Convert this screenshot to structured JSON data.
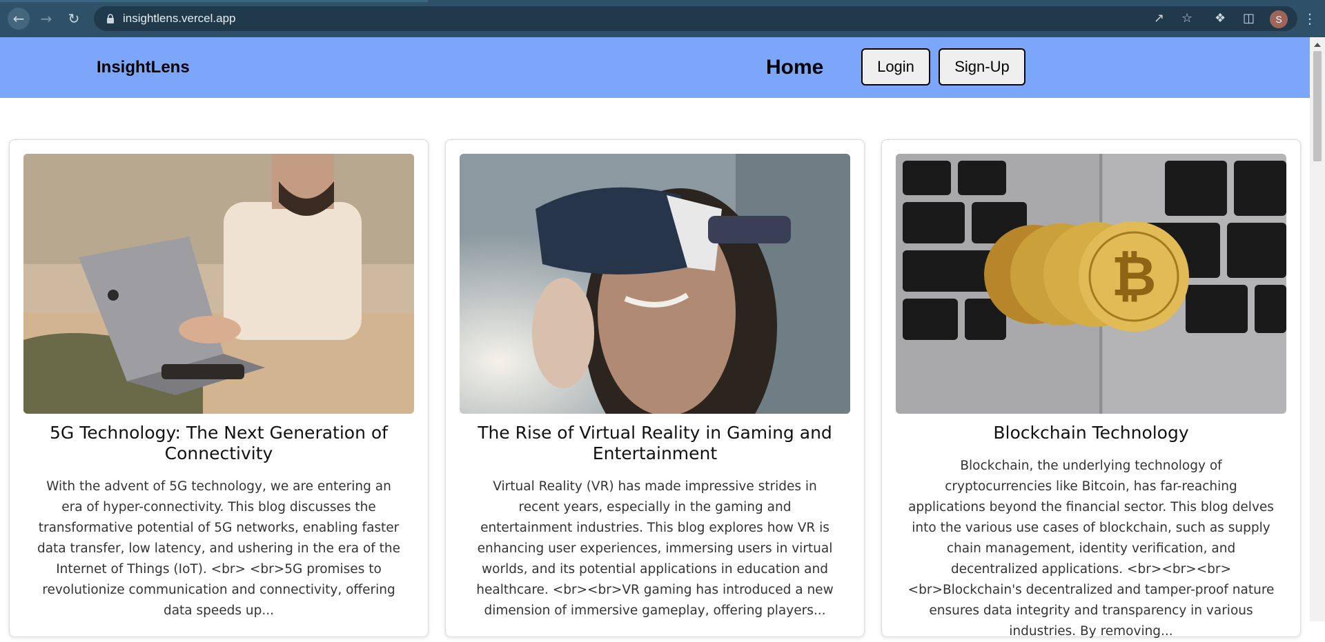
{
  "browser": {
    "url": "insightlens.vercel.app",
    "profile_initial": "S",
    "icons": [
      "back-icon",
      "forward-icon",
      "reload-icon",
      "lock-icon",
      "share-icon",
      "bookmark-star-icon",
      "extensions-icon",
      "side-panel-icon",
      "kebab-menu-icon"
    ]
  },
  "header": {
    "brand": "InsightLens",
    "nav_home": "Home",
    "login_label": "Login",
    "signup_label": "Sign-Up",
    "background_color": "#7ba6fa"
  },
  "posts": [
    {
      "title": "5G Technology: The Next Generation of Connectivity",
      "excerpt": "With the advent of 5G technology, we are entering an era of hyper-connectivity. This blog discusses the transformative potential of 5G networks, enabling faster data transfer, low latency, and ushering in the era of the Internet of Things (IoT). <br> <br>5G promises to revolutionize communication and connectivity, offering data speeds up..."
    },
    {
      "title": "The Rise of Virtual Reality in Gaming and Entertainment",
      "excerpt": "Virtual Reality (VR) has made impressive strides in recent years, especially in the gaming and entertainment industries. This blog explores how VR is enhancing user experiences, immersing users in virtual worlds, and its potential applications in education and healthcare. <br><br>VR gaming has introduced a new dimension of immersive gameplay, offering players..."
    },
    {
      "title": "Blockchain Technology",
      "excerpt": "Blockchain, the underlying technology of cryptocurrencies like Bitcoin, has far-reaching applications beyond the financial sector. This blog delves into the various use cases of blockchain, such as supply chain management, identity verification, and decentralized applications. <br><br><br><br>Blockchain's decentralized and tamper-proof nature ensures data integrity and transparency in various industries. By removing..."
    }
  ]
}
